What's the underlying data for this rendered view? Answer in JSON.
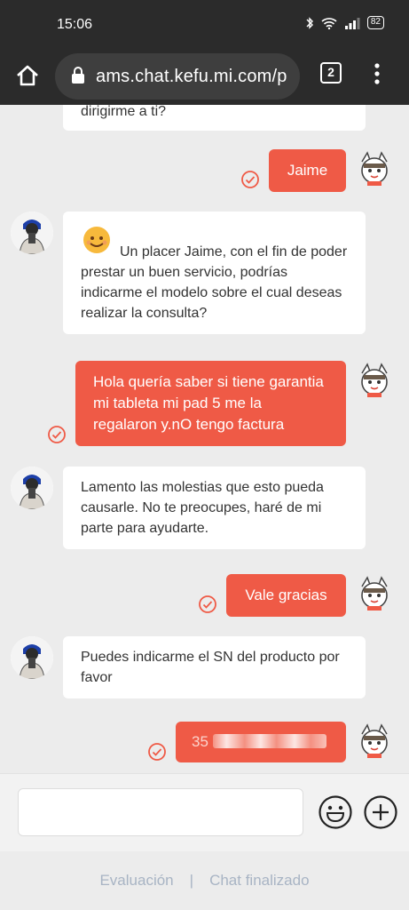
{
  "status_bar": {
    "time": "15:06",
    "battery": "82"
  },
  "browser": {
    "url": "ams.chat.kefu.mi.com/p",
    "tab_count": "2"
  },
  "messages": [
    {
      "side": "agent",
      "text": "dirigirme a ti?"
    },
    {
      "side": "user",
      "text": "Jaime"
    },
    {
      "side": "agent",
      "text": "Un placer Jaime, con el fin de poder prestar un buen servicio, podrías indicarme el modelo sobre el cual deseas realizar la consulta?",
      "emoji": "smiling-face"
    },
    {
      "side": "user",
      "text": "Hola quería saber si tiene garantia mi tableta mi pad 5 me la regalaron y.nO tengo factura"
    },
    {
      "side": "agent",
      "text": "Lamento las molestias que esto pueda causarle. No te preocupes, haré de mi parte para ayudarte."
    },
    {
      "side": "user",
      "text": "Vale gracias"
    },
    {
      "side": "agent",
      "text": "Puedes indicarme el SN del producto por favor"
    },
    {
      "side": "user",
      "text": "35",
      "redacted": true
    }
  ],
  "input": {
    "placeholder": ""
  },
  "footer": {
    "evaluation_label": "Evaluación",
    "separator": "|",
    "end_chat_label": "Chat finalizado"
  },
  "colors": {
    "accent": "#ef5a46",
    "chrome": "#2b2b2b",
    "footer_link": "#a8b4c4"
  }
}
